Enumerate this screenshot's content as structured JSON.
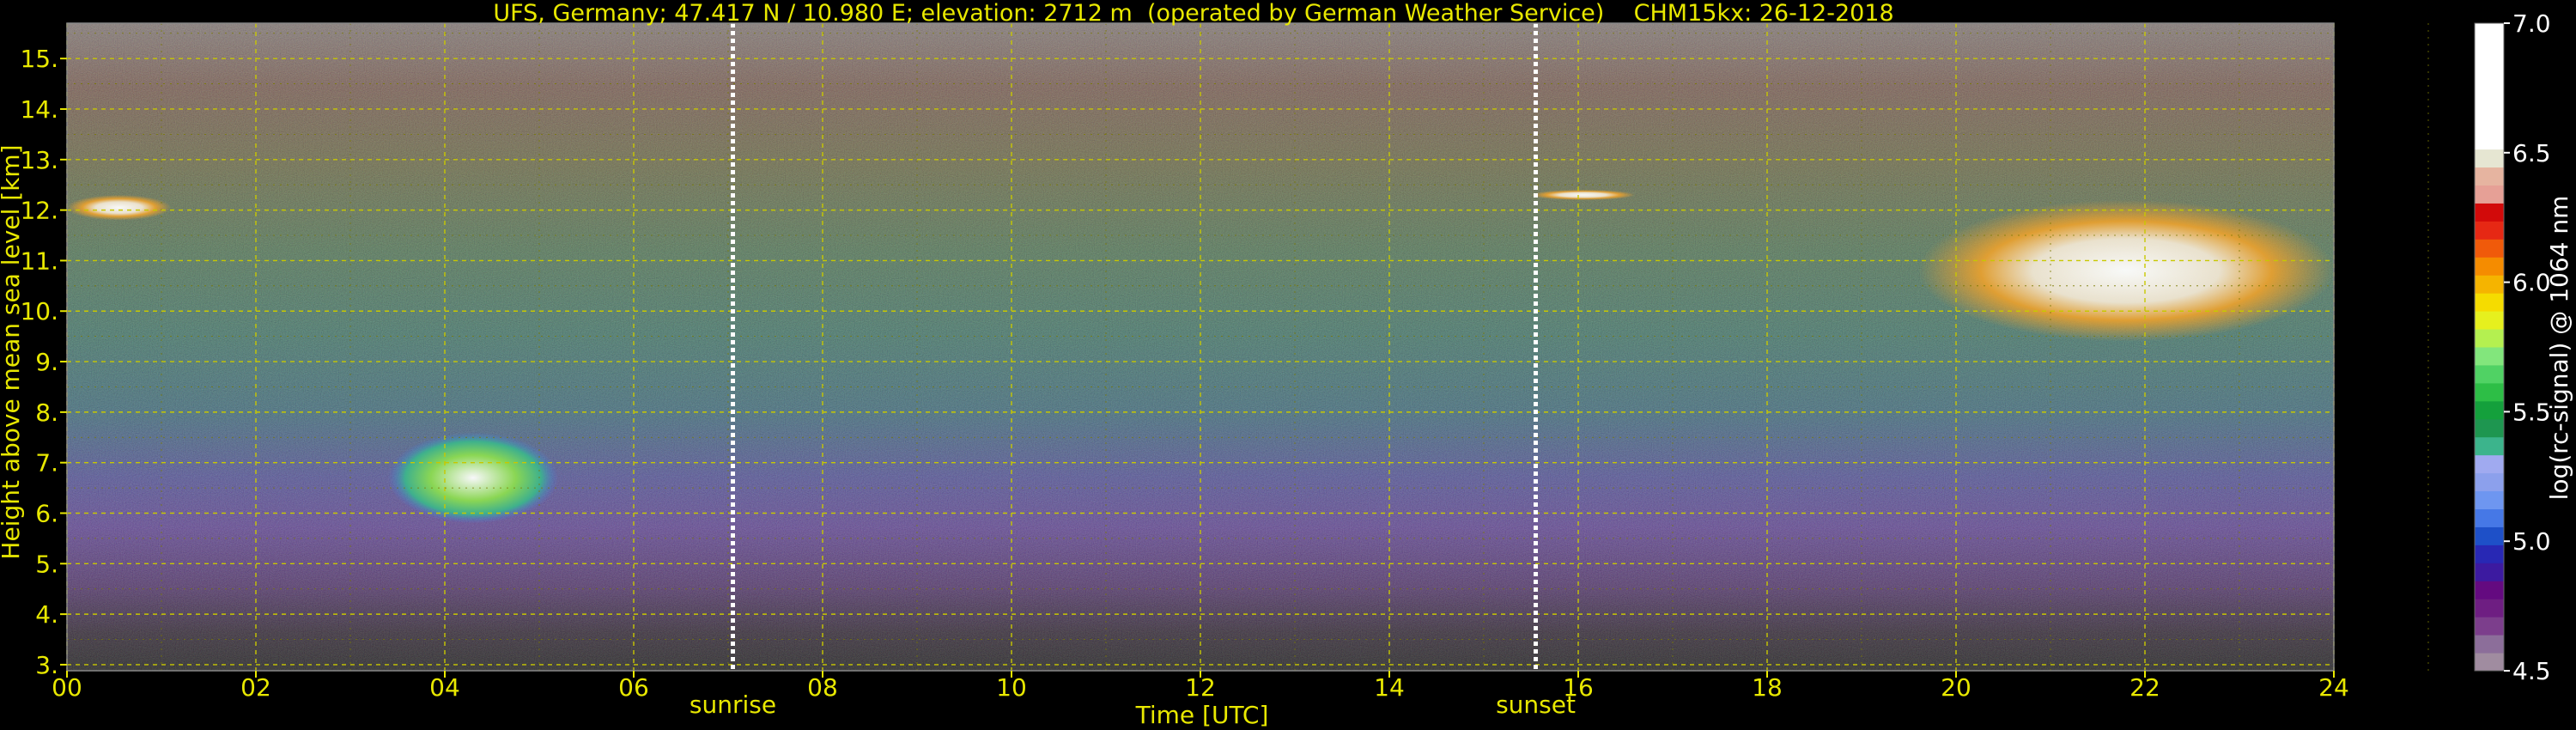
{
  "chart_data": {
    "type": "heatmap",
    "title": "UFS, Germany; 47.417 N / 10.980 E; elevation: 2712 m  (operated by German Weather Service)    CHM15kx: 26-12-2018",
    "xlabel": "Time [UTC]",
    "ylabel": "Height above mean sea level [km]",
    "xlim": [
      0,
      24
    ],
    "ylim": [
      2.88,
      15.7
    ],
    "x_ticks": [
      "00",
      "02",
      "04",
      "06",
      "08",
      "10",
      "12",
      "14",
      "16",
      "18",
      "20",
      "22",
      "24"
    ],
    "y_ticks": [
      "3.",
      "4.",
      "5.",
      "6.",
      "7.",
      "8.",
      "9.",
      "10.",
      "11.",
      "12.",
      "13.",
      "14.",
      "15."
    ],
    "grid": true,
    "markers": [
      {
        "label": "sunrise",
        "x": 7.05
      },
      {
        "label": "sunset",
        "x": 15.55
      }
    ],
    "colorbar": {
      "label": "log(rc-signal) @ 1064 nm",
      "range": [
        4.5,
        7.0
      ],
      "ticks": [
        "4.5",
        "5.0",
        "5.5",
        "6.0",
        "6.5",
        "7.0"
      ],
      "colors": [
        "#a08ca0",
        "#8c6e9a",
        "#7c3e8c",
        "#6e1e82",
        "#640a80",
        "#3c1aa0",
        "#2828b4",
        "#1e50c8",
        "#4678e6",
        "#6e96f0",
        "#8ca0ec",
        "#a0aaf0",
        "#3cb48c",
        "#1e9650",
        "#14a03c",
        "#2dbe46",
        "#50d264",
        "#82e67c",
        "#b4f050",
        "#e6f01e",
        "#f5dc00",
        "#f5b400",
        "#f58c00",
        "#f05a0a",
        "#e62814",
        "#d20a0a",
        "#e6a096",
        "#e6b4a0",
        "#e6e6d2",
        "#ffffff",
        "#ffffff",
        "#ffffff",
        "#ffffff",
        "#ffffff",
        "#ffffff",
        "#ffffff"
      ]
    },
    "features": [
      {
        "type": "cloud",
        "x_start": 0.0,
        "x_end": 1.1,
        "y_bottom": 11.8,
        "y_top": 12.3
      },
      {
        "type": "cloud",
        "x_start": 3.4,
        "x_end": 5.2,
        "y_bottom": 5.8,
        "y_top": 7.6
      },
      {
        "type": "cloud",
        "x_start": 15.5,
        "x_end": 16.6,
        "y_bottom": 12.2,
        "y_top": 12.4
      },
      {
        "type": "cloud",
        "x_start": 19.6,
        "x_end": 24.0,
        "y_bottom": 9.4,
        "y_top": 12.2
      }
    ]
  }
}
